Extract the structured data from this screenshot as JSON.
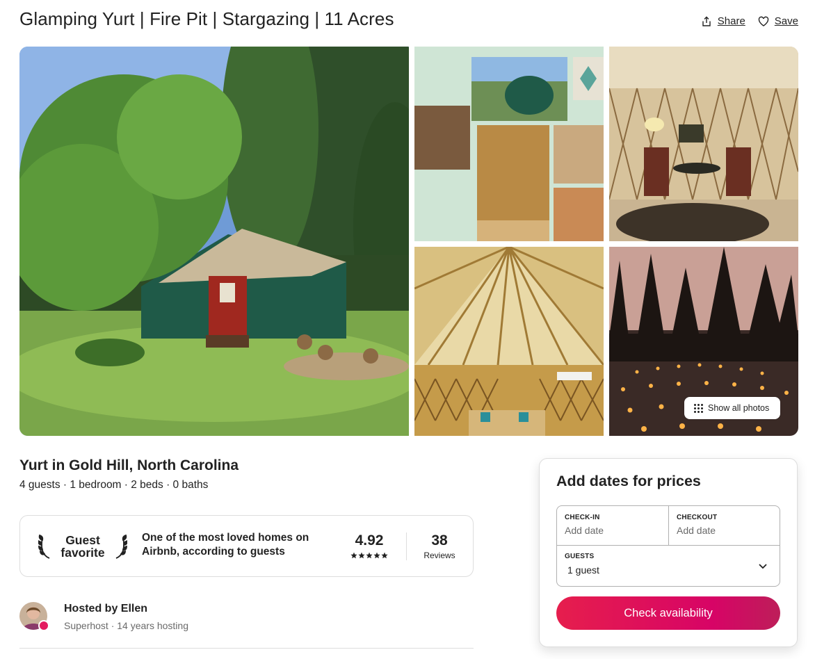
{
  "listing": {
    "title": "Glamping Yurt | Fire Pit | Stargazing | 11 Acres",
    "share_label": "Share",
    "save_label": "Save"
  },
  "gallery": {
    "photos": [
      {
        "name": "yurt-exterior-photo"
      },
      {
        "name": "collage-photo"
      },
      {
        "name": "interior-seating-photo"
      },
      {
        "name": "yurt-ceiling-photo"
      },
      {
        "name": "candle-labyrinth-photo"
      }
    ],
    "show_all_label": "Show all photos"
  },
  "details": {
    "subtitle": "Yurt in Gold Hill, North Carolina",
    "facts": "4 guests · 1 bedroom · 2 beds · 0 baths"
  },
  "guest_favorite": {
    "badge_line1": "Guest",
    "badge_line2": "favorite",
    "description": "One of the most loved homes on Airbnb, according to guests",
    "rating": "4.92",
    "stars": 5,
    "review_count": "38",
    "reviews_label": "Reviews"
  },
  "host": {
    "name_line": "Hosted by Ellen",
    "meta": "Superhost · 14 years hosting"
  },
  "booking": {
    "title": "Add dates for prices",
    "checkin_label": "CHECK-IN",
    "checkin_value": "Add date",
    "checkout_label": "CHECKOUT",
    "checkout_value": "Add date",
    "guests_label": "GUESTS",
    "guests_value": "1 guest",
    "cta_label": "Check availability",
    "accent_color": "#e31c5f"
  }
}
